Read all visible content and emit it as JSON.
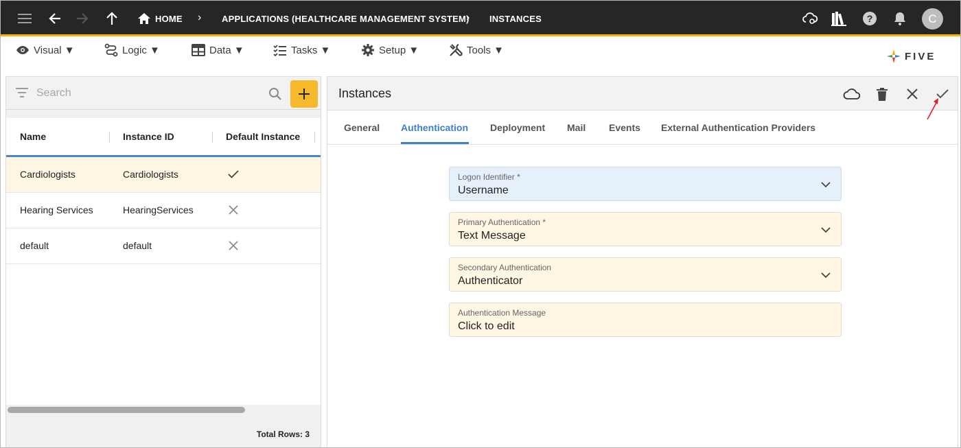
{
  "topbar": {
    "crumbs": [
      {
        "label": "HOME"
      },
      {
        "label": "APPLICATIONS (HEALTHCARE MANAGEMENT SYSTEM)"
      },
      {
        "label": "INSTANCES"
      }
    ],
    "avatar_initial": "C"
  },
  "menu": {
    "items": [
      {
        "label": "Visual ▼",
        "icon": "eye-icon"
      },
      {
        "label": "Logic ▼",
        "icon": "logic-icon"
      },
      {
        "label": "Data ▼",
        "icon": "table-icon"
      },
      {
        "label": "Tasks ▼",
        "icon": "tasks-icon"
      },
      {
        "label": "Setup ▼",
        "icon": "gear-icon"
      },
      {
        "label": "Tools ▼",
        "icon": "tools-icon"
      }
    ],
    "logo_text": "FIVE"
  },
  "list": {
    "search_placeholder": "Search",
    "columns": [
      "Name",
      "Instance ID",
      "Default Instance"
    ],
    "rows": [
      {
        "name": "Cardiologists",
        "instance_id": "Cardiologists",
        "default": true
      },
      {
        "name": "Hearing Services",
        "instance_id": "HearingServices",
        "default": false
      },
      {
        "name": "default",
        "instance_id": "default",
        "default": false
      }
    ],
    "total_rows": "Total Rows: 3"
  },
  "form": {
    "title": "Instances",
    "tabs": [
      "General",
      "Authentication",
      "Deployment",
      "Mail",
      "Events",
      "External Authentication Providers"
    ],
    "active_tab": "Authentication",
    "fields": [
      {
        "label": "Logon Identifier *",
        "value": "Username",
        "type": "select"
      },
      {
        "label": "Primary Authentication *",
        "value": "Text Message",
        "type": "select"
      },
      {
        "label": "Secondary Authentication",
        "value": "Authenticator",
        "type": "select"
      },
      {
        "label": "Authentication Message",
        "value": "Click to edit",
        "type": "text"
      }
    ]
  },
  "colors": {
    "topbar_bg": "#262626",
    "accent_yellow": "#f4b400",
    "add_button": "#f6b92b",
    "active_tab": "#3f7fc8",
    "selected_row": "#fff6e3",
    "field_bg": "#fff6e3",
    "field_bg_focused": "#e6f0fb",
    "annotation_arrow": "#e02020"
  }
}
